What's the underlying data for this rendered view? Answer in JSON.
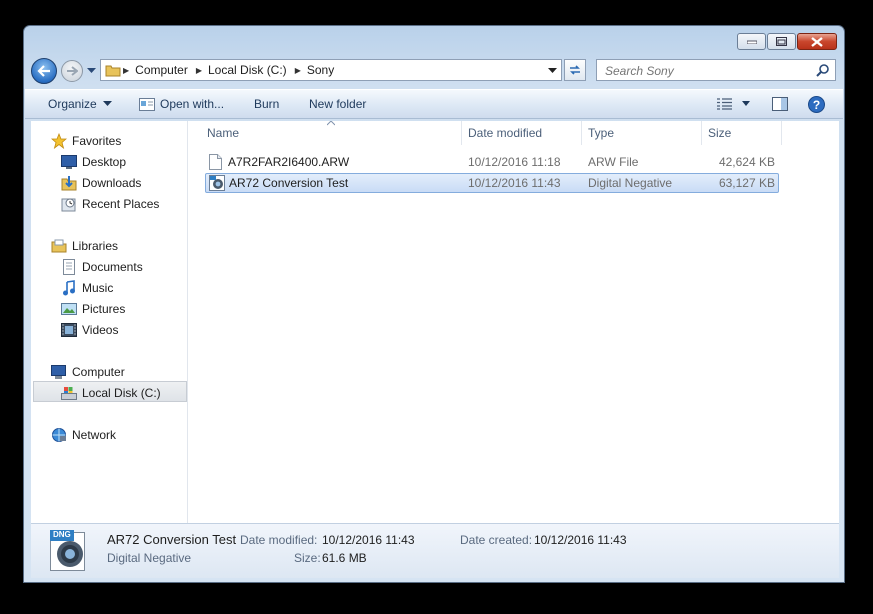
{
  "address": {
    "crumbs": [
      "Computer",
      "Local Disk (C:)",
      "Sony"
    ]
  },
  "search": {
    "placeholder": "Search Sony"
  },
  "toolbar": {
    "organize": "Organize",
    "open_with": "Open with...",
    "burn": "Burn",
    "new_folder": "New folder"
  },
  "nav": {
    "favorites": "Favorites",
    "desktop": "Desktop",
    "downloads": "Downloads",
    "recent_places": "Recent Places",
    "libraries": "Libraries",
    "documents": "Documents",
    "music": "Music",
    "pictures": "Pictures",
    "videos": "Videos",
    "computer": "Computer",
    "local_disk": "Local Disk (C:)",
    "network": "Network"
  },
  "columns": {
    "name": "Name",
    "date_modified": "Date modified",
    "type": "Type",
    "size": "Size"
  },
  "files": [
    {
      "name": "A7R2FAR2I6400.ARW",
      "date": "10/12/2016 11:18",
      "type": "ARW File",
      "size": "42,624 KB"
    },
    {
      "name": "AR72 Conversion Test",
      "date": "10/12/2016 11:43",
      "type": "Digital Negative",
      "size": "63,127 KB"
    }
  ],
  "details": {
    "icon_label": "DNG",
    "name": "AR72 Conversion Test",
    "type": "Digital Negative",
    "date_modified_label": "Date modified:",
    "date_modified": "10/12/2016 11:43",
    "date_created_label": "Date created:",
    "date_created": "10/12/2016 11:43",
    "size_label": "Size:",
    "size": "61.6 MB"
  },
  "colors": {
    "selection_border": "#84acdd",
    "close_button": "#c9462c"
  }
}
